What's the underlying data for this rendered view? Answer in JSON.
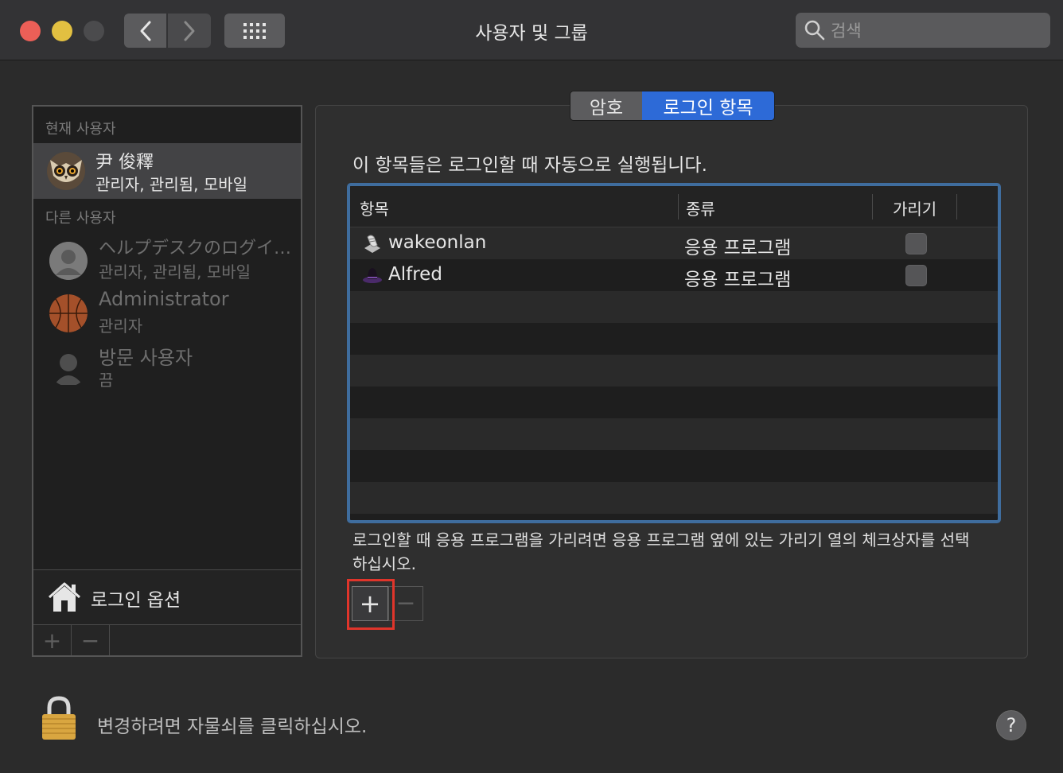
{
  "window": {
    "title": "사용자 및 그룹"
  },
  "search": {
    "placeholder": "검색"
  },
  "sidebar": {
    "current_label": "현재 사용자",
    "current_user": {
      "name": "尹 俊釋",
      "role": "관리자, 관리됨, 모바일",
      "avatar": "owl-avatar"
    },
    "other_label": "다른 사용자",
    "other_users": [
      {
        "name": "ヘルプデスクのログイ…",
        "role": "관리자, 관리됨, 모바일",
        "avatar": "person-silhouette-avatar"
      },
      {
        "name": "Administrator",
        "role": "관리자",
        "avatar": "basketball-avatar"
      },
      {
        "name": "방문 사용자",
        "role": "끔",
        "avatar": "guest-silhouette-avatar"
      }
    ],
    "login_options": "로그인 옵션",
    "add_symbol": "+",
    "remove_symbol": "−"
  },
  "tabs": {
    "password": "암호",
    "login_items": "로그인 항목",
    "selected": "로그인 항목"
  },
  "main": {
    "description": "이 항목들은 로그인할 때 자동으로 실행됩니다.",
    "columns": {
      "item": "항목",
      "kind": "종류",
      "hide": "가리기"
    },
    "rows": [
      {
        "name": "wakeonlan",
        "kind": "응용 프로그램",
        "hidden": false,
        "icon": "script-icon"
      },
      {
        "name": "Alfred",
        "kind": "응용 프로그램",
        "hidden": false,
        "icon": "alfred-hat-icon"
      }
    ],
    "hint": "로그인할 때 응용 프로그램을 가리려면 응용 프로그램 옆에 있는 가리기 열의 체크상자를 선택하십시오.",
    "add_symbol": "+",
    "remove_symbol": "−"
  },
  "footer": {
    "lock_message": "변경하려면 자물쇠를 클릭하십시오.",
    "help": "?"
  },
  "colors": {
    "accent": "#2d6ad7",
    "table_border": "#3f6d9e",
    "highlight": "#e0352b"
  }
}
